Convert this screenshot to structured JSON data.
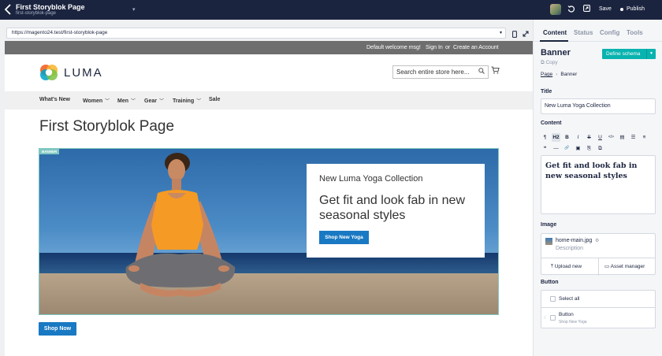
{
  "topbar": {
    "page_title": "First Storyblok Page",
    "page_slug": "first-storyblok-page",
    "save_label": "Save",
    "publish_label": "Publish"
  },
  "browser": {
    "url": "https://magento24.test/first-storyblok-page"
  },
  "store": {
    "welcome": "Default welcome msg!",
    "sign_in": "Sign In",
    "or": "or",
    "create_account": "Create an Account",
    "logo_text": "LUMA",
    "search_placeholder": "Search entire store here...",
    "nav": [
      {
        "label": "What's New",
        "dropdown": false
      },
      {
        "label": "Women",
        "dropdown": true
      },
      {
        "label": "Men",
        "dropdown": true
      },
      {
        "label": "Gear",
        "dropdown": true
      },
      {
        "label": "Training",
        "dropdown": true
      },
      {
        "label": "Sale",
        "dropdown": false
      }
    ],
    "page_heading": "First Storyblok Page",
    "banner": {
      "tag": "BANNER",
      "title": "New Luma Yoga Collection",
      "content": "Get fit and look fab in new seasonal styles",
      "button": "Shop New Yoga"
    },
    "shop_now": "Shop Now"
  },
  "sidebar": {
    "tabs": [
      "Content",
      "Status",
      "Config",
      "Tools"
    ],
    "active_tab": "Content",
    "component_title": "Banner",
    "copy_label": "Copy",
    "define_schema": "Define schema",
    "breadcrumb": {
      "parent": "Page",
      "current": "Banner"
    },
    "title_label": "Title",
    "title_value": "New Luma Yoga Collection",
    "content_label": "Content",
    "toolbar": [
      "¶",
      "H2",
      "B",
      "I",
      "S",
      "U",
      "</>",
      "▤",
      "☰",
      "≡",
      "❝",
      "—",
      "🔗",
      "▣",
      "⎘",
      "⧉"
    ],
    "content_value": "Get fit and look fab in new seasonal styles",
    "image_label": "Image",
    "image_name": "home-main.jpg",
    "image_desc": "Description",
    "upload_new": "Upload new",
    "asset_manager": "Asset manager",
    "button_label": "Button",
    "select_all": "Select all",
    "button_item": "Button",
    "button_item_sub": "Shop New Yoga"
  },
  "colors": {
    "topbar": "#1b243f",
    "accent_teal": "#09b3af",
    "luma_blue": "#1979c3",
    "banner_outline": "#7fc7c0"
  }
}
